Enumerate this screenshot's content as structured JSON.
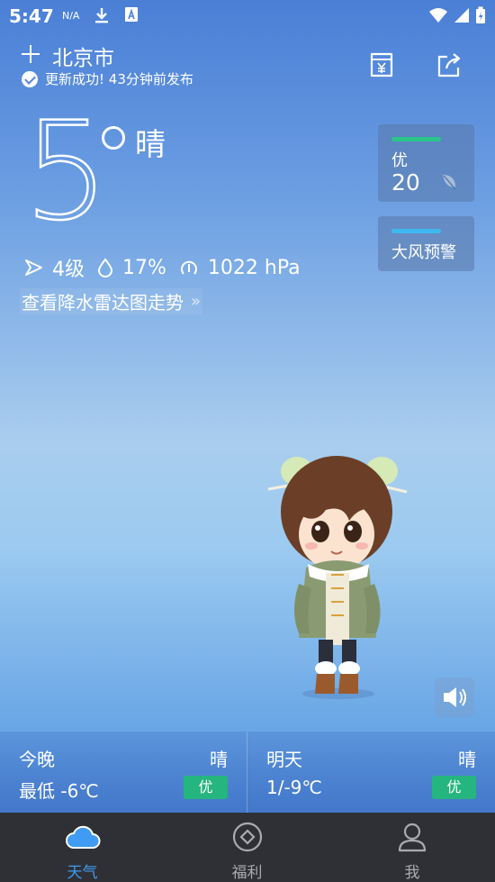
{
  "status_bar": {
    "time": "5:47",
    "network": "N/A"
  },
  "header": {
    "city": "北京市",
    "update_text": "更新成功! 43分钟前发布"
  },
  "current": {
    "temperature": "5",
    "condition": "晴",
    "wind": "4级",
    "humidity": "17%",
    "pressure": "1022 hPa",
    "radar_link": "查看降水雷达图走势"
  },
  "aqi": {
    "label": "优",
    "value": "20"
  },
  "warning": {
    "label": "大风预警"
  },
  "forecast": [
    {
      "day": "今晚",
      "condition": "晴",
      "temp": "最低 -6℃",
      "aqi": "优"
    },
    {
      "day": "明天",
      "condition": "晴",
      "temp": "1/-9℃",
      "aqi": "优"
    }
  ],
  "nav": [
    {
      "label": "天气",
      "icon": "cloud-icon"
    },
    {
      "label": "福利",
      "icon": "diamond-circle-icon"
    },
    {
      "label": "我",
      "icon": "person-icon"
    }
  ],
  "colors": {
    "aqi_good": "#25b57f",
    "warning_bar": "#3fb8f2",
    "nav_active": "#3f9cf2"
  }
}
